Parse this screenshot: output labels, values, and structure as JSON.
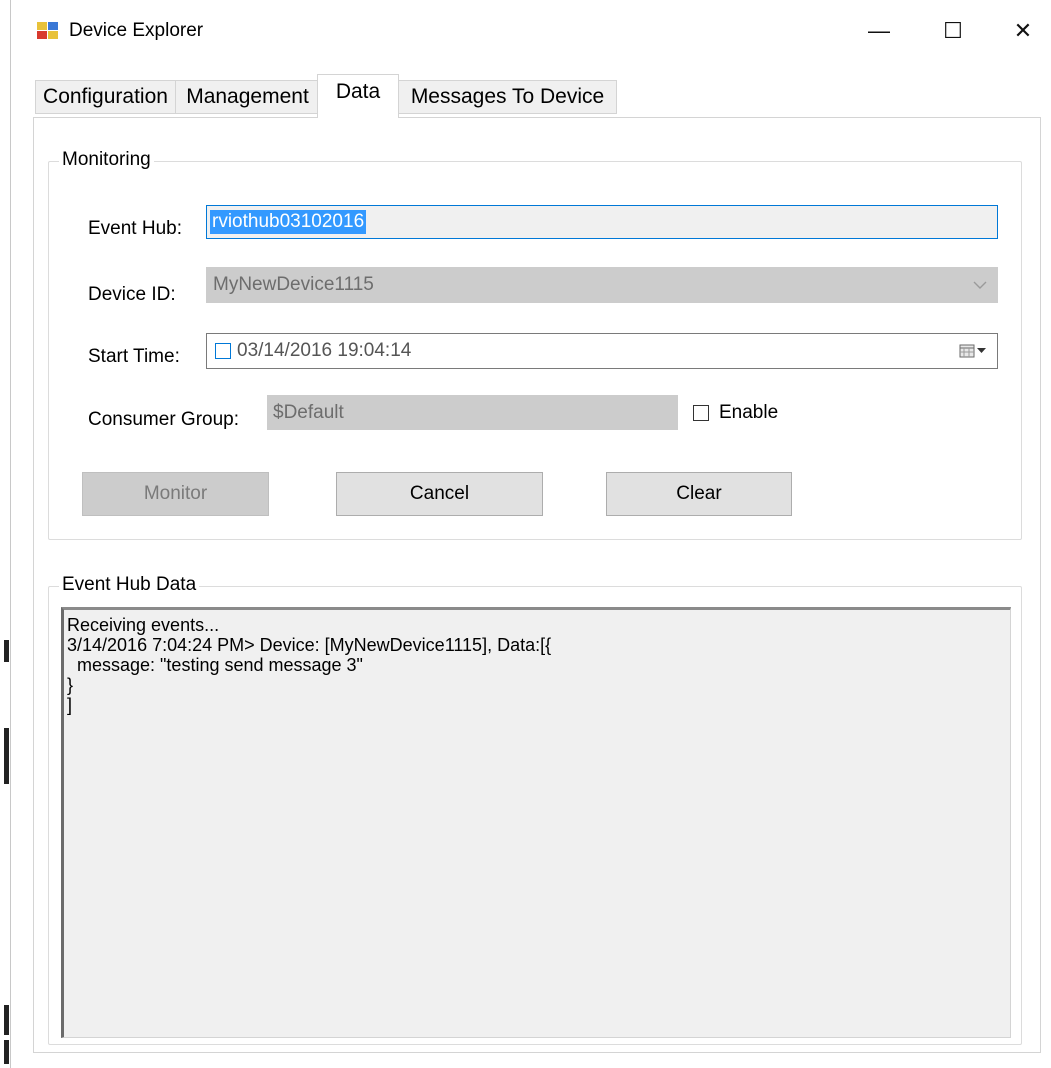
{
  "window": {
    "title": "Device Explorer",
    "controls": {
      "minimize": "—",
      "maximize": "☐",
      "close": "✕"
    }
  },
  "tabs": [
    {
      "label": "Configuration",
      "active": false
    },
    {
      "label": "Management",
      "active": false
    },
    {
      "label": "Data",
      "active": true
    },
    {
      "label": "Messages To Device",
      "active": false
    }
  ],
  "monitoring": {
    "legend": "Monitoring",
    "event_hub_label": "Event Hub:",
    "event_hub_value": "rviothub03102016",
    "device_id_label": "Device ID:",
    "device_id_value": "MyNewDevice1115",
    "start_time_label": "Start Time:",
    "start_time_value": "03/14/2016 19:04:14",
    "start_time_checked": false,
    "consumer_group_label": "Consumer Group:",
    "consumer_group_value": "$Default",
    "enable_label": "Enable",
    "enable_checked": false,
    "buttons": {
      "monitor": "Monitor",
      "cancel": "Cancel",
      "clear": "Clear"
    }
  },
  "event_hub_data": {
    "legend": "Event Hub Data",
    "lines": [
      "Receiving events...",
      "3/14/2016 7:04:24 PM> Device: [MyNewDevice1115], Data:[{",
      "  message: \"testing send message 3\"",
      "}",
      "]"
    ]
  },
  "colors": {
    "selection": "#3399ff",
    "focus_border": "#0078d7",
    "disabled_bg": "#cccccc",
    "button_bg": "#e1e1e1",
    "log_bg": "#f0f0f0"
  },
  "icons": {
    "app": "device-explorer-icon",
    "dropdown": "chevron-down-icon",
    "calendar": "calendar-icon"
  }
}
